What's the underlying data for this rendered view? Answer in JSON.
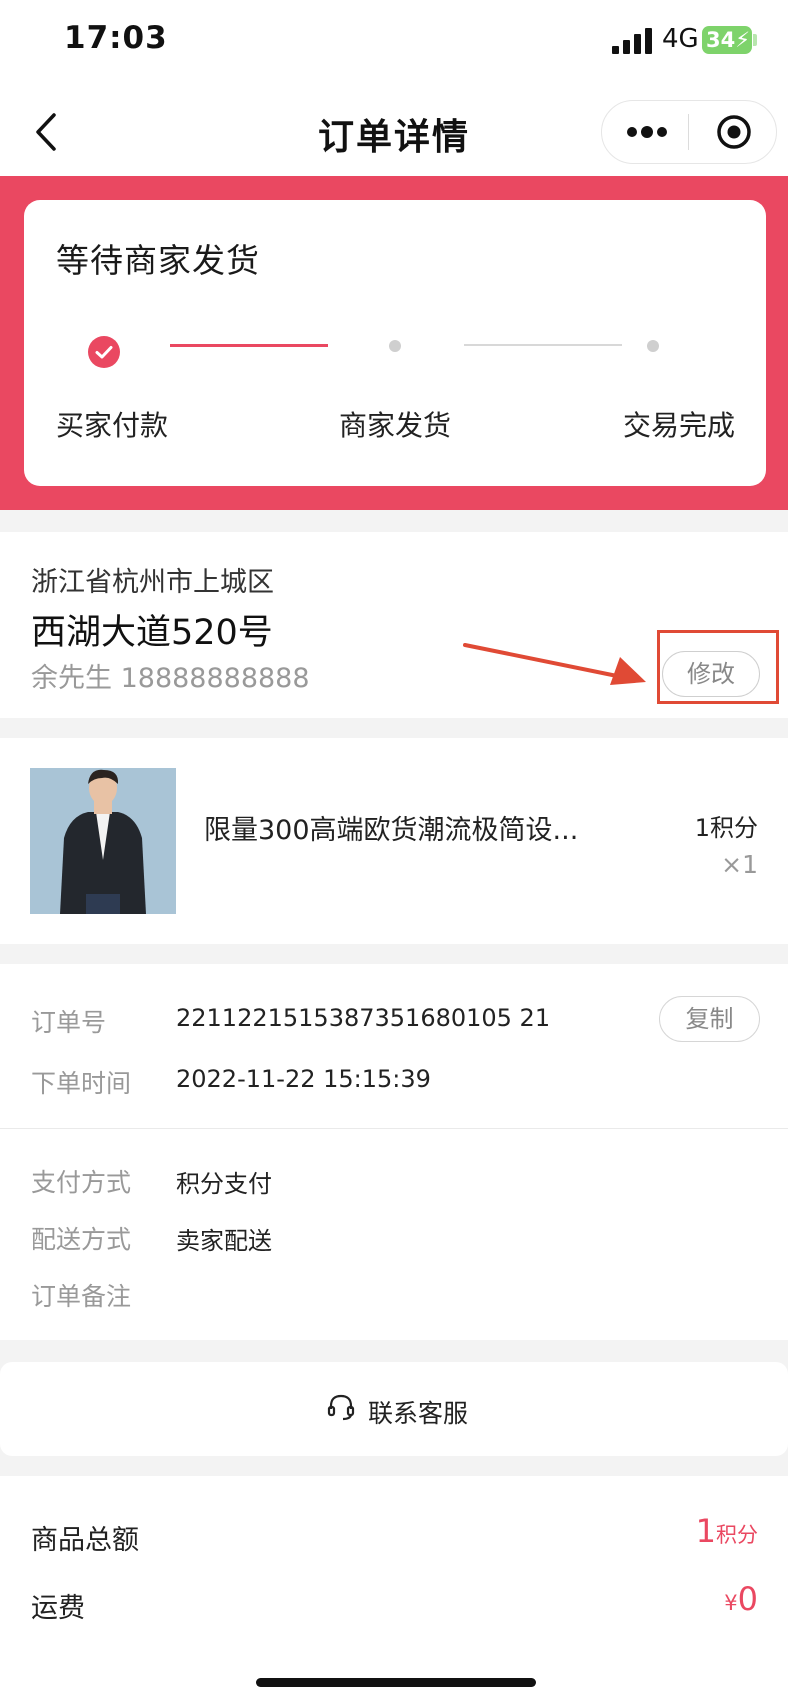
{
  "status_bar": {
    "time": "17:03",
    "network": "4G",
    "battery": "34"
  },
  "nav": {
    "title": "订单详情"
  },
  "order_status": {
    "title": "等待商家发货",
    "steps": [
      {
        "label": "买家付款",
        "state": "done"
      },
      {
        "label": "商家发货",
        "state": "pending"
      },
      {
        "label": "交易完成",
        "state": "pending"
      }
    ]
  },
  "address": {
    "region": "浙江省杭州市上城区",
    "street": "西湖大道520号",
    "contact": "余先生 18888888888",
    "modify_label": "修改"
  },
  "product": {
    "name": "限量300高端欧货潮流极简设...",
    "price": "1积分",
    "quantity": "×1"
  },
  "order_info": {
    "order_no_label": "订单号",
    "order_no": "2211221515387351680105 21",
    "copy_label": "复制",
    "time_label": "下单时间",
    "time": "2022-11-22 15:15:39",
    "payment_label": "支付方式",
    "payment": "积分支付",
    "delivery_label": "配送方式",
    "delivery": "卖家配送",
    "remark_label": "订单备注"
  },
  "service": {
    "label": "联系客服"
  },
  "totals": {
    "goods_label": "商品总额",
    "goods_value": "1",
    "goods_unit": "积分",
    "shipping_label": "运费",
    "shipping_currency": "¥",
    "shipping_value": "0"
  },
  "colors": {
    "accent": "#ea4861",
    "annotation": "#e04a35"
  }
}
